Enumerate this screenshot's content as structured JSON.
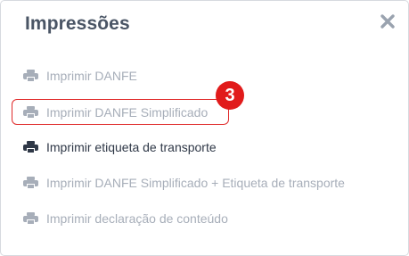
{
  "modal": {
    "title": "Impressões",
    "close_icon": "close-icon"
  },
  "items": [
    {
      "label": "Imprimir DANFE",
      "icon": "printer-icon",
      "state": "disabled"
    },
    {
      "label": "Imprimir DANFE Simplificado",
      "icon": "printer-icon",
      "state": "disabled"
    },
    {
      "label": "Imprimir etiqueta de transporte",
      "icon": "printer-icon",
      "state": "enabled"
    },
    {
      "label": "Imprimir DANFE Simplificado + Etiqueta de transporte",
      "icon": "printer-icon",
      "state": "disabled"
    },
    {
      "label": "Imprimir declaração de conteúdo",
      "icon": "printer-icon",
      "state": "disabled"
    }
  ],
  "annotation": {
    "step_number": "3",
    "color": "#e11b1b"
  },
  "colors": {
    "title": "#4a5565",
    "enabled_text": "#2f3847",
    "disabled_text": "#a7aeb9"
  }
}
